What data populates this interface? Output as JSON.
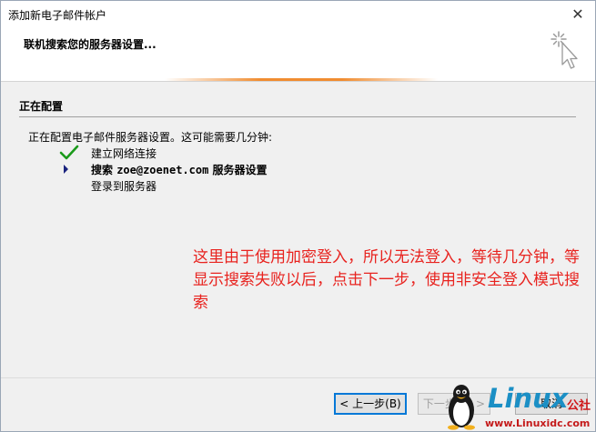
{
  "window": {
    "title": "添加新电子邮件帐户",
    "close_glyph": "✕"
  },
  "header": {
    "title": "联机搜索您的服务器设置..."
  },
  "section": {
    "title": "正在配置",
    "description": "正在配置电子邮件服务器设置。这可能需要几分钟:"
  },
  "steps": [
    {
      "label": "建立网络连接",
      "state": "done",
      "icon": "checkmark-icon"
    },
    {
      "label_prefix": "搜索 ",
      "label_mono": "zoe@zoenet.com",
      "label_suffix": " 服务器设置",
      "state": "active",
      "icon": "triangle-right-icon"
    },
    {
      "label": "登录到服务器",
      "state": "pending"
    }
  ],
  "annotation": {
    "text": "这里由于使用加密登入，所以无法登入，等待几分钟，等显示搜索失败以后，点击下一步，使用非安全登入模式搜索"
  },
  "buttons": {
    "back": "< 上一步(B)",
    "next": "下一步(N) >",
    "cancel": "取消"
  },
  "watermark": {
    "logo": "Linux",
    "cn": "公社",
    "url": "www.Linuxidc.com"
  },
  "colors": {
    "annotation": "#e8231f",
    "check": "#1a9a1a",
    "arrow": "#1a237e",
    "progress": "#f08c30",
    "accent_border": "#0078d7"
  }
}
